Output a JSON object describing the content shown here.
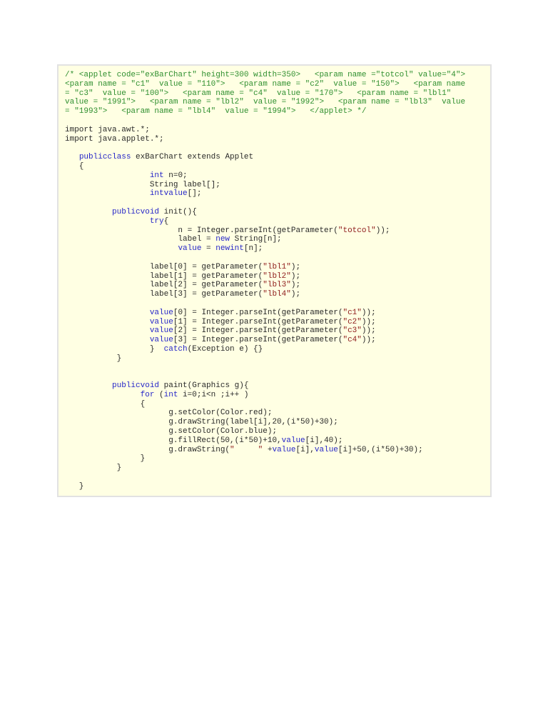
{
  "colors": {
    "comment": "#2f8f2f",
    "keyword": "#2626c8",
    "string": "#8e1b1b",
    "text": "#2a2a2a",
    "background": "#ffffe3"
  },
  "code_lines": [
    [
      {
        "c": "m",
        "t": "/* <applet code=\"exBarChart\" height=300 width=350>   <param name =\"totcol\" value=\"4\">"
      }
    ],
    [
      {
        "c": "m",
        "t": "<param name = \"c1\"  value = \"110\">   <param name = \"c2\"  value = \"150\">   <param name"
      }
    ],
    [
      {
        "c": "m",
        "t": "= \"c3\"  value = \"100\">   <param name = \"c4\"  value = \"170\">   <param name = \"lbl1\""
      }
    ],
    [
      {
        "c": "m",
        "t": "value = \"1991\">   <param name = \"lbl2\"  value = \"1992\">   <param name = \"lbl3\"  value"
      }
    ],
    [
      {
        "c": "m",
        "t": "= \"1993\">   <param name = \"lbl4\"  value = \"1994\">   </applet> */"
      }
    ],
    [],
    [
      {
        "c": "n",
        "t": "import java.awt.*;"
      }
    ],
    [
      {
        "c": "n",
        "t": "import java.applet.*;"
      }
    ],
    [],
    [
      {
        "c": "n",
        "t": "   "
      },
      {
        "c": "k",
        "t": "publicclass"
      },
      {
        "c": "n",
        "t": " exBarChart extends Applet"
      }
    ],
    [
      {
        "c": "n",
        "t": "   {"
      }
    ],
    [
      {
        "c": "n",
        "t": "                  "
      },
      {
        "c": "k",
        "t": "int"
      },
      {
        "c": "n",
        "t": " n=0;"
      }
    ],
    [
      {
        "c": "n",
        "t": "                  String label[];"
      }
    ],
    [
      {
        "c": "n",
        "t": "                  "
      },
      {
        "c": "k",
        "t": "intvalue"
      },
      {
        "c": "n",
        "t": "[];"
      }
    ],
    [],
    [
      {
        "c": "n",
        "t": "          "
      },
      {
        "c": "k",
        "t": "publicvoid"
      },
      {
        "c": "n",
        "t": " init(){"
      }
    ],
    [
      {
        "c": "n",
        "t": "                  "
      },
      {
        "c": "k",
        "t": "try"
      },
      {
        "c": "n",
        "t": "{"
      }
    ],
    [
      {
        "c": "n",
        "t": "                        n = Integer.parseInt(getParameter("
      },
      {
        "c": "s",
        "t": "\"totcol\""
      },
      {
        "c": "n",
        "t": "));"
      }
    ],
    [
      {
        "c": "n",
        "t": "                        label = "
      },
      {
        "c": "k",
        "t": "new"
      },
      {
        "c": "n",
        "t": " String[n];"
      }
    ],
    [
      {
        "c": "n",
        "t": "                        "
      },
      {
        "c": "k",
        "t": "value"
      },
      {
        "c": "n",
        "t": " = "
      },
      {
        "c": "k",
        "t": "newint"
      },
      {
        "c": "n",
        "t": "[n];"
      }
    ],
    [],
    [
      {
        "c": "n",
        "t": "                  label[0] = getParameter("
      },
      {
        "c": "s",
        "t": "\"lbl1\""
      },
      {
        "c": "n",
        "t": ");"
      }
    ],
    [
      {
        "c": "n",
        "t": "                  label[1] = getParameter("
      },
      {
        "c": "s",
        "t": "\"lbl2\""
      },
      {
        "c": "n",
        "t": ");"
      }
    ],
    [
      {
        "c": "n",
        "t": "                  label[2] = getParameter("
      },
      {
        "c": "s",
        "t": "\"lbl3\""
      },
      {
        "c": "n",
        "t": ");"
      }
    ],
    [
      {
        "c": "n",
        "t": "                  label[3] = getParameter("
      },
      {
        "c": "s",
        "t": "\"lbl4\""
      },
      {
        "c": "n",
        "t": ");"
      }
    ],
    [],
    [
      {
        "c": "n",
        "t": "                  "
      },
      {
        "c": "k",
        "t": "value"
      },
      {
        "c": "n",
        "t": "[0] = Integer.parseInt(getParameter("
      },
      {
        "c": "s",
        "t": "\"c1\""
      },
      {
        "c": "n",
        "t": "));"
      }
    ],
    [
      {
        "c": "n",
        "t": "                  "
      },
      {
        "c": "k",
        "t": "value"
      },
      {
        "c": "n",
        "t": "[1] = Integer.parseInt(getParameter("
      },
      {
        "c": "s",
        "t": "\"c2\""
      },
      {
        "c": "n",
        "t": "));"
      }
    ],
    [
      {
        "c": "n",
        "t": "                  "
      },
      {
        "c": "k",
        "t": "value"
      },
      {
        "c": "n",
        "t": "[2] = Integer.parseInt(getParameter("
      },
      {
        "c": "s",
        "t": "\"c3\""
      },
      {
        "c": "n",
        "t": "));"
      }
    ],
    [
      {
        "c": "n",
        "t": "                  "
      },
      {
        "c": "k",
        "t": "value"
      },
      {
        "c": "n",
        "t": "[3] = Integer.parseInt(getParameter("
      },
      {
        "c": "s",
        "t": "\"c4\""
      },
      {
        "c": "n",
        "t": "));"
      }
    ],
    [
      {
        "c": "n",
        "t": "                  }  "
      },
      {
        "c": "k",
        "t": "catch"
      },
      {
        "c": "n",
        "t": "(Exception e) {}"
      }
    ],
    [
      {
        "c": "n",
        "t": "           }"
      }
    ],
    [],
    [],
    [
      {
        "c": "n",
        "t": "          "
      },
      {
        "c": "k",
        "t": "publicvoid"
      },
      {
        "c": "n",
        "t": " paint(Graphics g){"
      }
    ],
    [
      {
        "c": "n",
        "t": "                "
      },
      {
        "c": "k",
        "t": "for"
      },
      {
        "c": "n",
        "t": " ("
      },
      {
        "c": "k",
        "t": "int"
      },
      {
        "c": "n",
        "t": " i=0;i<n ;i++ )"
      }
    ],
    [
      {
        "c": "n",
        "t": "                {"
      }
    ],
    [
      {
        "c": "n",
        "t": "                      g.setColor(Color.red);"
      }
    ],
    [
      {
        "c": "n",
        "t": "                      g.drawString(label[i],20,(i*50)+30);"
      }
    ],
    [
      {
        "c": "n",
        "t": "                      g.setColor(Color.blue);"
      }
    ],
    [
      {
        "c": "n",
        "t": "                      g.fillRect(50,(i*50)+10,"
      },
      {
        "c": "k",
        "t": "value"
      },
      {
        "c": "n",
        "t": "[i],40);"
      }
    ],
    [
      {
        "c": "n",
        "t": "                      g.drawString("
      },
      {
        "c": "s",
        "t": "\"     \""
      },
      {
        "c": "n",
        "t": " +"
      },
      {
        "c": "k",
        "t": "value"
      },
      {
        "c": "n",
        "t": "[i],"
      },
      {
        "c": "k",
        "t": "value"
      },
      {
        "c": "n",
        "t": "[i]+50,(i*50)+30);"
      }
    ],
    [
      {
        "c": "n",
        "t": "                }"
      }
    ],
    [
      {
        "c": "n",
        "t": "           }"
      }
    ],
    [],
    [
      {
        "c": "n",
        "t": "   }"
      }
    ]
  ]
}
